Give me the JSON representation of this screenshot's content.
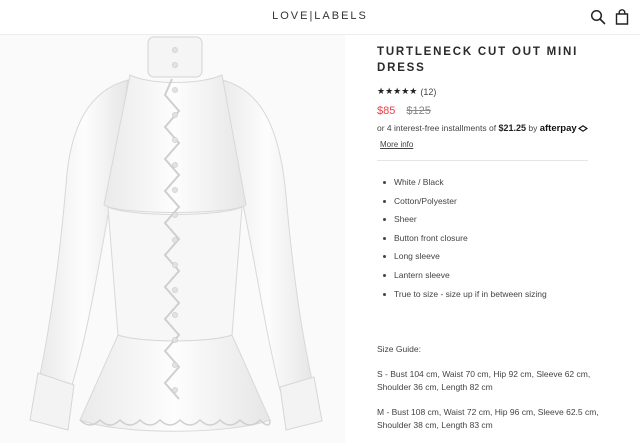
{
  "header": {
    "logo": "LOVE|LABELS",
    "icons": [
      "search-icon",
      "bag-icon"
    ]
  },
  "product": {
    "title": "TURTLENECK CUT OUT MINI DRESS",
    "rating": {
      "stars": 5,
      "count_label": "(12)"
    },
    "price_sale": "$85",
    "price_original": "$125",
    "installments": {
      "prefix": "or 4 interest-free installments of",
      "amount": "$21.25",
      "by": "by",
      "provider": "afterpay",
      "more_info": "More info"
    },
    "features": [
      "White / Black",
      "Cotton/Polyester",
      "Sheer",
      "Button front closure",
      "Long sleeve",
      "Lantern sleeve",
      "True to size - size up if in between sizing"
    ],
    "size_guide": {
      "title": "Size Guide:",
      "sizes": [
        "S - Bust 104 cm, Waist 70 cm, Hip 92 cm, Sleeve 62 cm, Shoulder 36 cm, Length 82 cm",
        "M - Bust 108 cm, Waist 72 cm, Hip 96 cm, Sleeve 62.5 cm, Shoulder 38 cm, Length 83 cm"
      ]
    }
  },
  "colors": {
    "sale": "#e8414b",
    "text": "#333333",
    "divider": "#e6e6e6"
  }
}
